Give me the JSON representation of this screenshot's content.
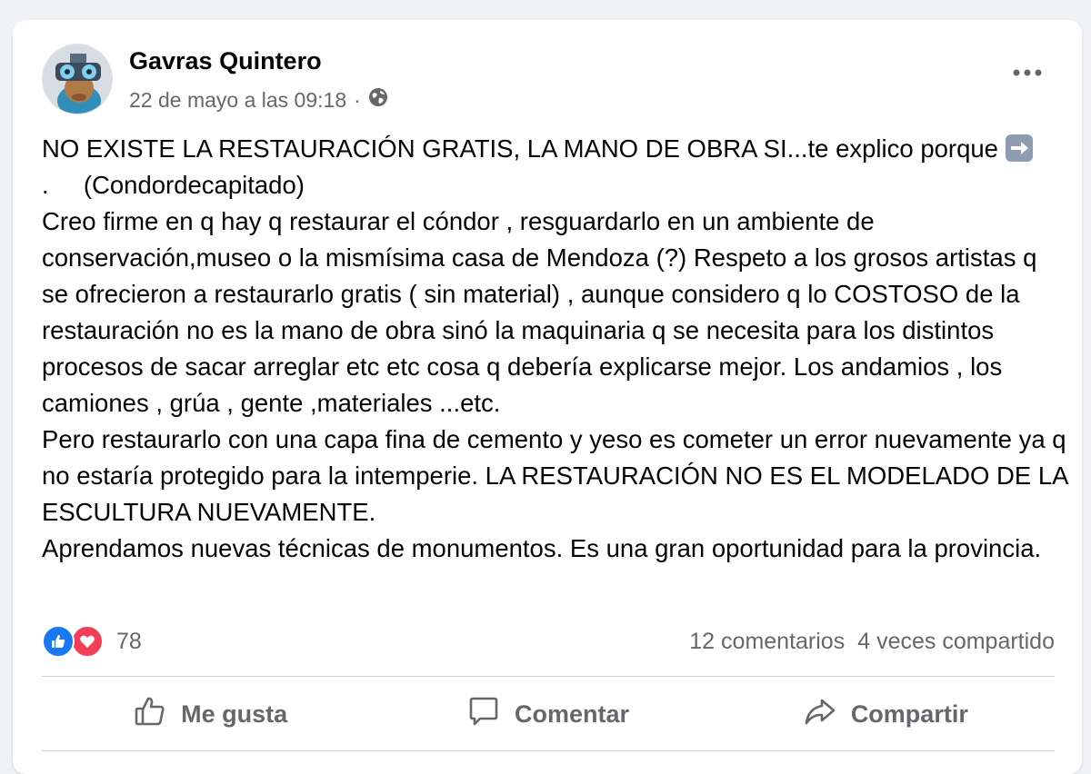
{
  "post": {
    "author": "Gavras Quintero",
    "timestamp": "22 de mayo a las 09:18",
    "separator": "·",
    "audience_icon": "globe-icon",
    "more_icon": "more-options-icon",
    "text_line1": "NO EXISTE LA RESTAURACIÓN GRATIS, LA MANO DE OBRA SI...te explico porque",
    "emoji": "➡️",
    "text_rest": ".     (Condordecapitado)\nCreo firme en q hay q restaurar el cóndor , resguardarlo en un ambiente de conservación,museo o la mismísima casa de Mendoza (?) Respeto a los grosos artistas q se ofrecieron a restaurarlo gratis ( sin material) , aunque considero q lo COSTOSO de la restauración no es la mano de obra sinó la maquinaria q se necesita para los distintos procesos de sacar arreglar etc etc cosa q debería explicarse mejor. Los andamios , los camiones , grúa , gente ,materiales ...etc.\nPero restaurarlo con una capa fina de cemento y yeso es cometer un error nuevamente ya q no estaría protegido para la intemperie. LA RESTAURACIÓN NO ES EL MODELADO DE LA ESCULTURA NUEVAMENTE.\nAprendamos nuevas técnicas de monumentos. Es una gran oportunidad para la provincia."
  },
  "stats": {
    "reaction_icons": [
      "like-reaction-icon",
      "love-reaction-icon"
    ],
    "reaction_count": "78",
    "comments": "12 comentarios",
    "shares": "4 veces compartido"
  },
  "actions": {
    "like_label": "Me gusta",
    "comment_label": "Comentar",
    "share_label": "Compartir"
  },
  "colors": {
    "text_primary": "#050505",
    "text_secondary": "#65676b",
    "like_blue": "#1877f2",
    "love_red": "#f33e58",
    "background": "#f0f2f5"
  }
}
